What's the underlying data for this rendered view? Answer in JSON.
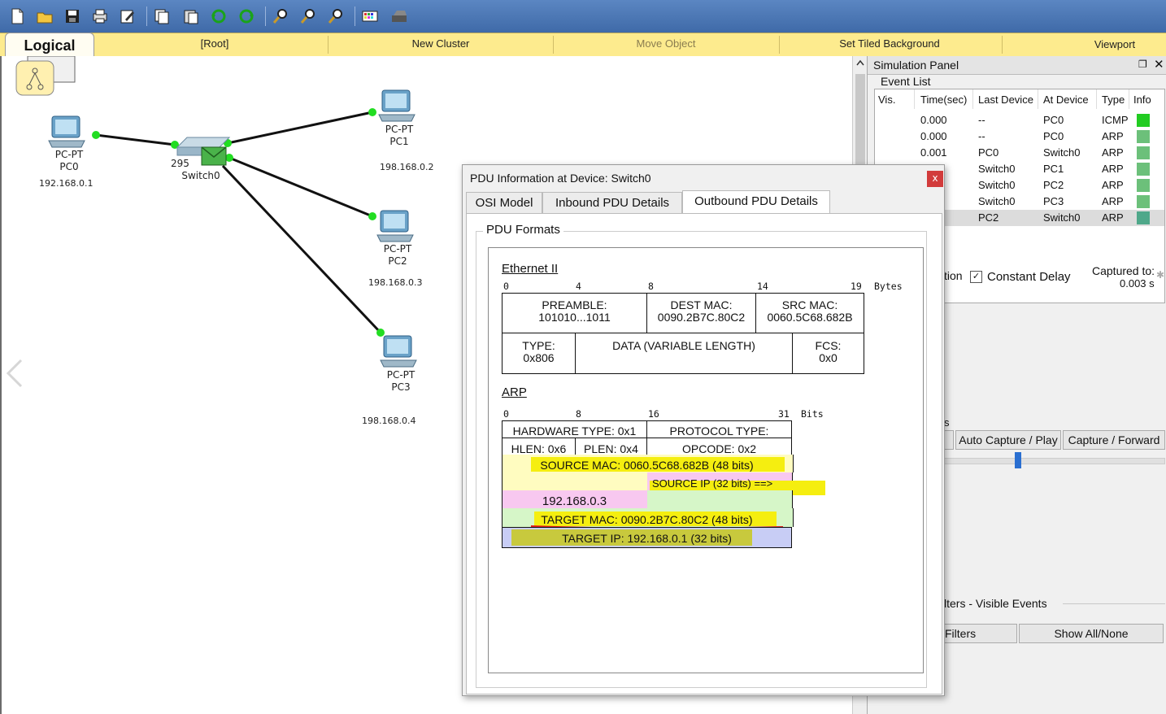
{
  "toolbar": {
    "icons": [
      "new-file-icon",
      "open-folder-icon",
      "save-icon",
      "print-icon",
      "edit-icon",
      "copy-icon",
      "paste-icon",
      "undo-icon",
      "redo-icon",
      "zoom-in-icon",
      "zoom-reset-icon",
      "zoom-out-icon",
      "palette-icon",
      "device-template-icon"
    ]
  },
  "topbar": {
    "logical": "Logical",
    "root": "[Root]",
    "new_cluster": "New Cluster",
    "move_object": "Move Object",
    "set_tiled_background": "Set Tiled Background",
    "viewport": "Viewport"
  },
  "topology": {
    "pc0": {
      "type": "PC-PT",
      "name": "PC0",
      "ip": "192.168.0.1"
    },
    "pc1": {
      "type": "PC-PT",
      "name": "PC1",
      "ip": "198.168.0.2"
    },
    "pc2": {
      "type": "PC-PT",
      "name": "PC2",
      "ip": "198.168.0.3"
    },
    "pc3": {
      "type": "PC-PT",
      "name": "PC3",
      "ip": "198.168.0.4"
    },
    "switch": {
      "model": "295",
      "name": "Switch0"
    }
  },
  "simulation_panel": {
    "title": "Simulation Panel",
    "event_list": "Event List",
    "columns": [
      "Vis.",
      "Time(sec)",
      "Last Device",
      "At Device",
      "Type",
      "Info"
    ],
    "events": [
      {
        "time": "0.000",
        "last": "--",
        "at": "PC0",
        "type": "ICMP",
        "color": "#22cc22"
      },
      {
        "time": "0.000",
        "last": "--",
        "at": "PC0",
        "type": "ARP",
        "color": "#6cc07a"
      },
      {
        "time": "0.001",
        "last": "PC0",
        "at": "Switch0",
        "type": "ARP",
        "color": "#6cc07a"
      },
      {
        "time": "",
        "last": "Switch0",
        "at": "PC1",
        "type": "ARP",
        "color": "#6cc07a"
      },
      {
        "time": "",
        "last": "Switch0",
        "at": "PC2",
        "type": "ARP",
        "color": "#6cc07a"
      },
      {
        "time": "",
        "last": "Switch0",
        "at": "PC3",
        "type": "ARP",
        "color": "#6cc07a"
      },
      {
        "time": "",
        "last": "PC2",
        "at": "Switch0",
        "type": "ARP",
        "color": "#4fa88a"
      }
    ],
    "partial_tion": "tion",
    "constant_delay": "Constant Delay",
    "captured_to_label": "Captured to:",
    "captured_to_value": "0.003 s",
    "partial_s": "s",
    "auto_capture": "Auto Capture / Play",
    "capture_forward": "Capture / Forward",
    "filters_visible": "lters - Visible Events",
    "filters_btn": "Filters",
    "show_all": "Show All/None"
  },
  "pdu_dialog": {
    "title": "PDU Information at Device: Switch0",
    "close": "x",
    "tabs": [
      "OSI Model",
      "Inbound PDU Details",
      "Outbound PDU Details"
    ],
    "group_label": "PDU Formats",
    "ethernet": {
      "title": "Ethernet II",
      "scale": [
        "0",
        "4",
        "8",
        "14",
        "19"
      ],
      "unit": "Bytes",
      "preamble": [
        "PREAMBLE:",
        "101010...1011"
      ],
      "dest_mac": [
        "DEST MAC:",
        "0090.2B7C.80C2"
      ],
      "src_mac": [
        "SRC MAC:",
        "0060.5C68.682B"
      ],
      "type": [
        "TYPE:",
        "0x806"
      ],
      "data": "DATA (VARIABLE LENGTH)",
      "fcs": [
        "FCS:",
        "0x0"
      ]
    },
    "arp": {
      "title": "ARP",
      "scale": [
        "0",
        "8",
        "16",
        "31"
      ],
      "unit": "Bits",
      "hw_type": "HARDWARE TYPE: 0x1",
      "proto_type": "PROTOCOL TYPE:",
      "hlen": "HLEN: 0x6",
      "plen": "PLEN: 0x4",
      "opcode": "OPCODE: 0x2",
      "source_mac": "SOURCE MAC: 0060.5C68.682B (48 bits)",
      "source_ip": "SOURCE IP (32 bits) ==>",
      "source_ip_value": "192.168.0.3",
      "target_mac": "TARGET MAC: 0090.2B7C.80C2 (48 bits)",
      "target_ip": "TARGET IP: 192.168.0.1 (32 bits)"
    }
  }
}
